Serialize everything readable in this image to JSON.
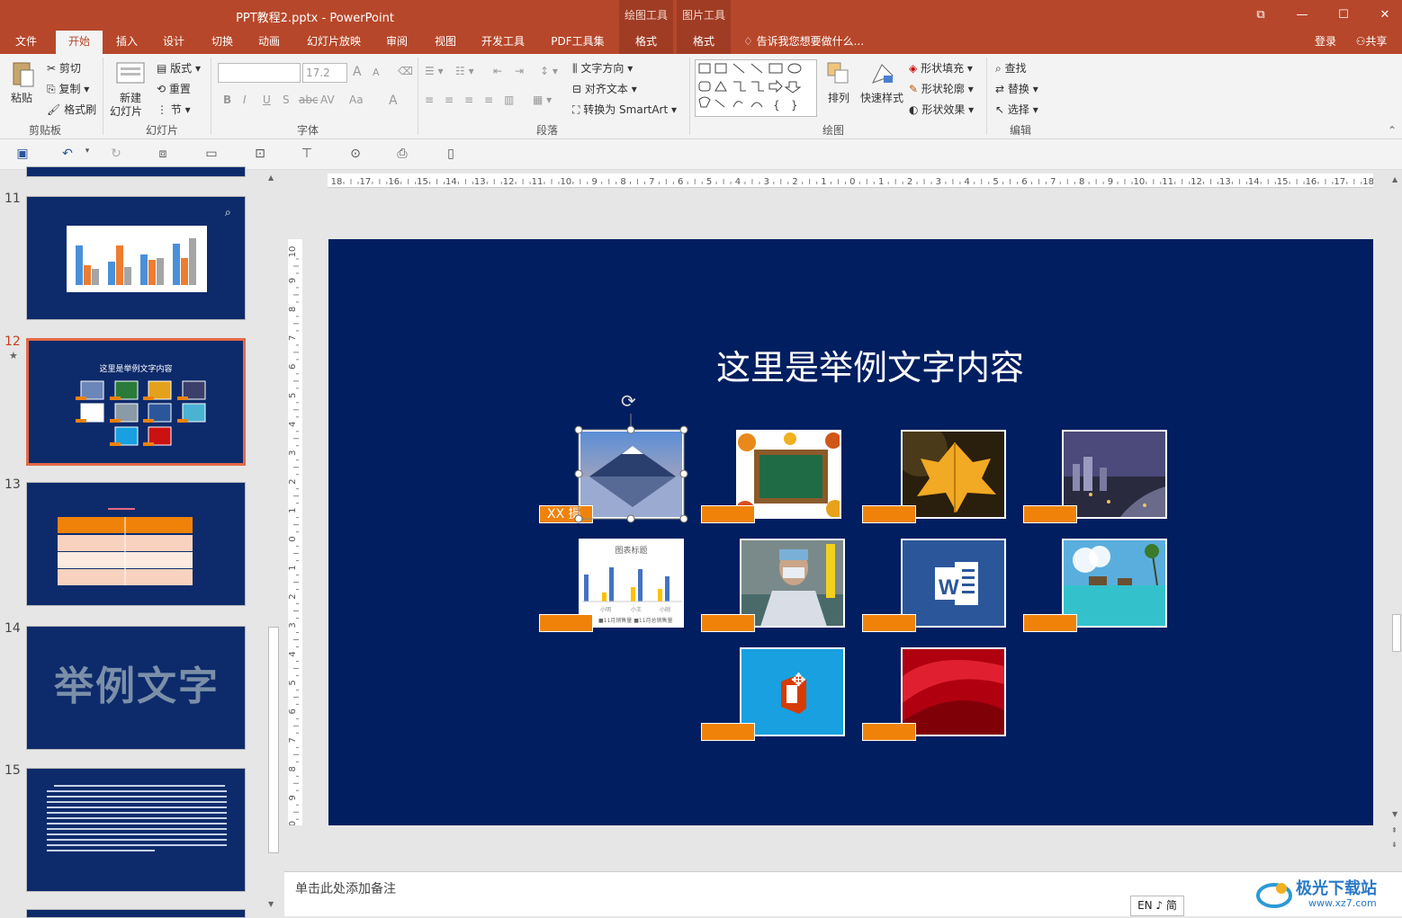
{
  "window": {
    "title": "PPT教程2.pptx - PowerPoint",
    "context_tabs": [
      "绘图工具",
      "图片工具"
    ],
    "controls": {
      "restore": "⧉",
      "minimize": "—",
      "maximize": "☐",
      "close": "✕"
    }
  },
  "tabs": [
    "文件",
    "开始",
    "插入",
    "设计",
    "切换",
    "动画",
    "幻灯片放映",
    "审阅",
    "视图",
    "开发工具",
    "PDF工具集",
    "格式",
    "格式"
  ],
  "tell_me": "告诉我您想要做什么...",
  "account": {
    "login": "登录",
    "share": "共享"
  },
  "ribbon": {
    "clipboard": {
      "paste": "粘贴",
      "cut": "剪切",
      "copy": "复制",
      "format_painter": "格式刷",
      "group": "剪贴板"
    },
    "slides": {
      "new_slide": "新建",
      "new_slide2": "幻灯片",
      "layout": "版式",
      "reset": "重置",
      "section": "节",
      "group": "幻灯片"
    },
    "font": {
      "size": "17.2",
      "group": "字体",
      "bold": "B",
      "italic": "I",
      "underline": "U",
      "shadow": "S",
      "strike": "abc",
      "spacing": "AV",
      "case": "Aa",
      "color": "A",
      "grow": "A",
      "shrink": "A"
    },
    "paragraph": {
      "text_direction": "文字方向",
      "align_text": "对齐文本",
      "smartart": "转换为 SmartArt",
      "group": "段落"
    },
    "drawing": {
      "arrange": "排列",
      "quick_styles": "快速样式",
      "fill": "形状填充",
      "outline": "形状轮廓",
      "effects": "形状效果",
      "group": "绘图"
    },
    "editing": {
      "find": "查找",
      "replace": "替换",
      "select": "选择",
      "group": "编辑"
    }
  },
  "thumbnails": [
    {
      "num": "11"
    },
    {
      "num": "12",
      "title": "这里是举例文字内容",
      "star": "★"
    },
    {
      "num": "13"
    },
    {
      "num": "14",
      "title": "举例文字"
    },
    {
      "num": "15"
    }
  ],
  "slide": {
    "title": "这里是举例文字内容",
    "first_tag": "XX 摄"
  },
  "chart_thumb": {
    "title": "图表标题",
    "legend1": "11月销售量",
    "legend2": "11月总销售量",
    "labels": [
      "小明",
      "小红",
      "小王",
      "小刚"
    ]
  },
  "ruler_h": [
    "18",
    "17",
    "16",
    "15",
    "14",
    "13",
    "12",
    "11",
    "10",
    "9",
    "8",
    "7",
    "6",
    "5",
    "4",
    "3",
    "2",
    "1",
    "0",
    "1",
    "2",
    "3",
    "4",
    "5",
    "6",
    "7",
    "8",
    "9",
    "10",
    "11",
    "12",
    "13",
    "14",
    "15",
    "16",
    "17",
    "18"
  ],
  "ruler_v": [
    "10",
    "9",
    "8",
    "7",
    "6",
    "5",
    "4",
    "3",
    "2",
    "1",
    "0",
    "1",
    "2",
    "3",
    "4",
    "5",
    "6",
    "7",
    "8",
    "9",
    "10"
  ],
  "notes_placeholder": "单击此处添加备注",
  "ime": "EN ♪ 简",
  "watermark": {
    "cn": "极光下载站",
    "url": "www.xz7.com"
  }
}
